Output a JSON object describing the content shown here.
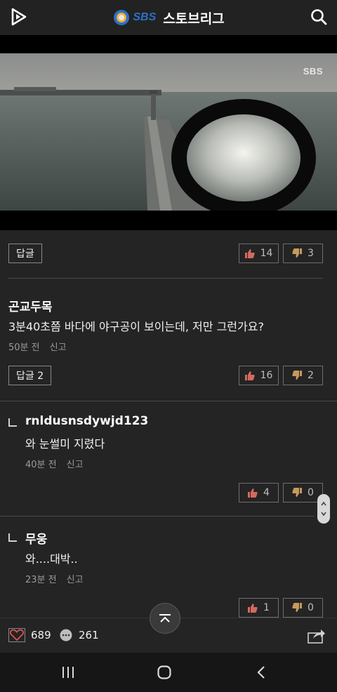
{
  "header": {
    "brand_logo_text": "SBS",
    "title": "스토브리그"
  },
  "video": {
    "watermark": "SBS"
  },
  "post_actions": {
    "reply_label": "답글",
    "like_count": "14",
    "dislike_count": "3"
  },
  "comments": [
    {
      "author": "곤교두목",
      "text": "3분40초쯤 바다에 야구공이 보이는데, 저만 그런가요?",
      "time": "50분 전",
      "report": "신고",
      "reply_label": "답글 2",
      "like_count": "16",
      "dislike_count": "2"
    }
  ],
  "replies": [
    {
      "author": "rnldusnsdywjd123",
      "text": "와 눈썰미 지렸다",
      "time": "40분 전",
      "report": "신고",
      "like_count": "4",
      "dislike_count": "0"
    },
    {
      "author": "무웅",
      "text": "와....대박..",
      "time": "23분 전",
      "report": "신고",
      "like_count": "1",
      "dislike_count": "0"
    }
  ],
  "footer": {
    "likes": "689",
    "comments": "261"
  },
  "colors": {
    "background": "#242424",
    "brand_blue": "#2f6fc9",
    "heart": "#d9534f"
  }
}
